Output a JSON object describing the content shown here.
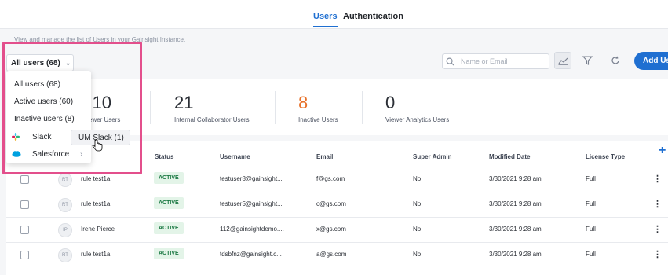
{
  "tabs": [
    {
      "label": "Users",
      "active": true
    },
    {
      "label": "Authentication",
      "active": false
    }
  ],
  "header": {
    "description": "View and manage the list of Users in your Gainsight Instance.",
    "filter_label": "All users (68)",
    "search_placeholder": "Name or Email",
    "add_user_label": "Add Us"
  },
  "stats": [
    {
      "value": "10",
      "label": "Viewer Users"
    },
    {
      "value": "21",
      "label": "Internal Collaborator Users"
    },
    {
      "value": "8",
      "label": "Inactive Users"
    },
    {
      "value": "0",
      "label": "Viewer Analytics Users"
    }
  ],
  "dropdown": {
    "items": [
      "All users (68)",
      "Active users (60)",
      "Inactive users (8)"
    ],
    "integrations": [
      {
        "label": "Slack",
        "icon": "slack-icon"
      },
      {
        "label": "Salesforce",
        "icon": "salesforce-icon"
      }
    ],
    "submenu_item": "UM Slack (1)"
  },
  "table": {
    "headers": [
      "Status",
      "Username",
      "Email",
      "Super Admin",
      "Modified Date",
      "License Type"
    ],
    "rows": [
      {
        "initials": "RT",
        "name": "rule test1a",
        "status": "ACTIVE",
        "username": "testuser8@gainsight...",
        "email": "f@gs.com",
        "super_admin": "No",
        "modified": "3/30/2021 9:28 am",
        "license": "Full"
      },
      {
        "initials": "RT",
        "name": "rule test1a",
        "status": "ACTIVE",
        "username": "testuser5@gainsight...",
        "email": "c@gs.com",
        "super_admin": "No",
        "modified": "3/30/2021 9:28 am",
        "license": "Full"
      },
      {
        "initials": "IP",
        "name": "Irene Pierce",
        "status": "ACTIVE",
        "username": "112@gainsightdemo....",
        "email": "x@gs.com",
        "super_admin": "No",
        "modified": "3/30/2021 9:28 am",
        "license": "Full"
      },
      {
        "initials": "RT",
        "name": "rule test1a",
        "status": "ACTIVE",
        "username": "tdsbfnz@gainsight.c...",
        "email": "a@gs.com",
        "super_admin": "No",
        "modified": "3/30/2021 9:28 am",
        "license": "Full"
      }
    ]
  },
  "colors": {
    "accent": "#1f6fd1",
    "highlight": "#e34f8c",
    "inactive_stat": "#e8722b",
    "active_badge_bg": "#e3f4e8"
  }
}
